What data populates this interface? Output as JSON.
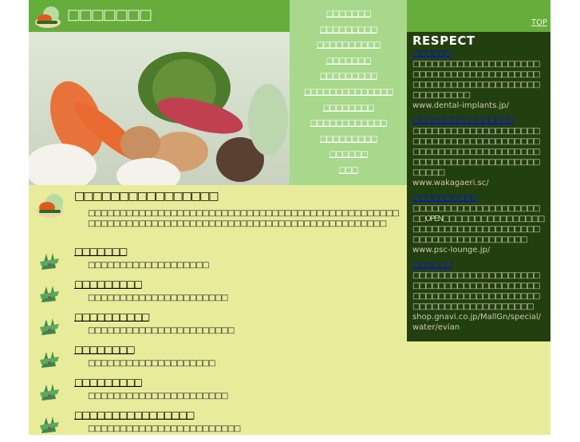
{
  "header": {
    "site_title": "□□□□□□□",
    "top_link": "TOP"
  },
  "nav": [
    "□□□□□□□",
    "□□□□□□□□□",
    "□□□□□□□□□□",
    "□□□□□□□",
    "□□□□□□□□□",
    "□□□□□□□□□□□□□□",
    "□□□□□□□□",
    "□□□□□□□□□□□□",
    "□□□□□□□□□",
    "□□□□□□",
    "□□□"
  ],
  "respect": {
    "title": "RESPECT",
    "items": [
      {
        "link": "□□□□□□",
        "text": "□□□□□□□□□□□□□□□□□□□□□□□□□□□□□□□□□□□□□□□□□□□□□□□□□□□□□□□□□□□□□□□□□□□□□",
        "url": "www.dental-implants.jp/"
      },
      {
        "link": "□□□□□□□□□□□□□□□□",
        "text": "□□□□□□□□□□□□□□□□□□□□□□□□□□□□□□□□□□□□□□□□□□□□□□□□□□□□□□□□□□□□□□□□□□□□□□□□□□□□□□□□□□□□□",
        "url": "www.wakagaeri.sc/"
      },
      {
        "link": "□□□□□□□ □□□",
        "text": "□□□□□□□□□□□□□□□□□□□□□□OPEN□□□□□□□□□□□□□□□□□□□□□□□□□□□□□□□□□□□□□□□□□□□□□□□□□□□□□□",
        "url": "www.psc-lounge.jp/"
      },
      {
        "link": "□□□□ □□",
        "text": "□□□□□□□□□□□□□□□□□□□□□□□□□□□□□□□□□□□□□□□□□□□□□□□□□□□□□□□□□□□□□□□□□□□□□□□□□□□□□□□",
        "url": "shop.gnavi.co.jp/MallGn/special/water/evian"
      }
    ]
  },
  "main": {
    "title": "□□□□□□□□□□□□□□□□",
    "intro": "□□□□□□□□□□□□□□□□□□□□□□□□□□□□□□□□□□□□□□□□□□□□□□□□□□□□□□□□□□□□□□□□□□□□□□□□□□□□□□□□□□□□□□□□□□□□□□□□",
    "items": [
      {
        "title": "□□□□□□□",
        "desc": "□□□□□□□□□□□□□□□□□□□"
      },
      {
        "title": "□□□□□□□□□",
        "desc": "□□□□□□□□□□□□□□□□□□□□□□"
      },
      {
        "title": "□□□□□□□□□□",
        "desc": "□□□□□□□□□□□□□□□□□□□□□□□"
      },
      {
        "title": "□□□□□□□□",
        "desc": "□□□□□□□□□□□□□□□□□□□□"
      },
      {
        "title": "□□□□□□□□□",
        "desc": "□□□□□□□□□□□□□□□□□□□□□□"
      },
      {
        "title": "□□□□□□□□□□□□□□□□",
        "desc": "□□□□□□□□□□□□□□□□□□□□□□□□"
      }
    ]
  },
  "colors": {
    "header": "#66ad3c",
    "nav": "#a8d88c",
    "sidebar": "#22400f",
    "main": "#e8eb9a",
    "link": "#0010e0"
  }
}
